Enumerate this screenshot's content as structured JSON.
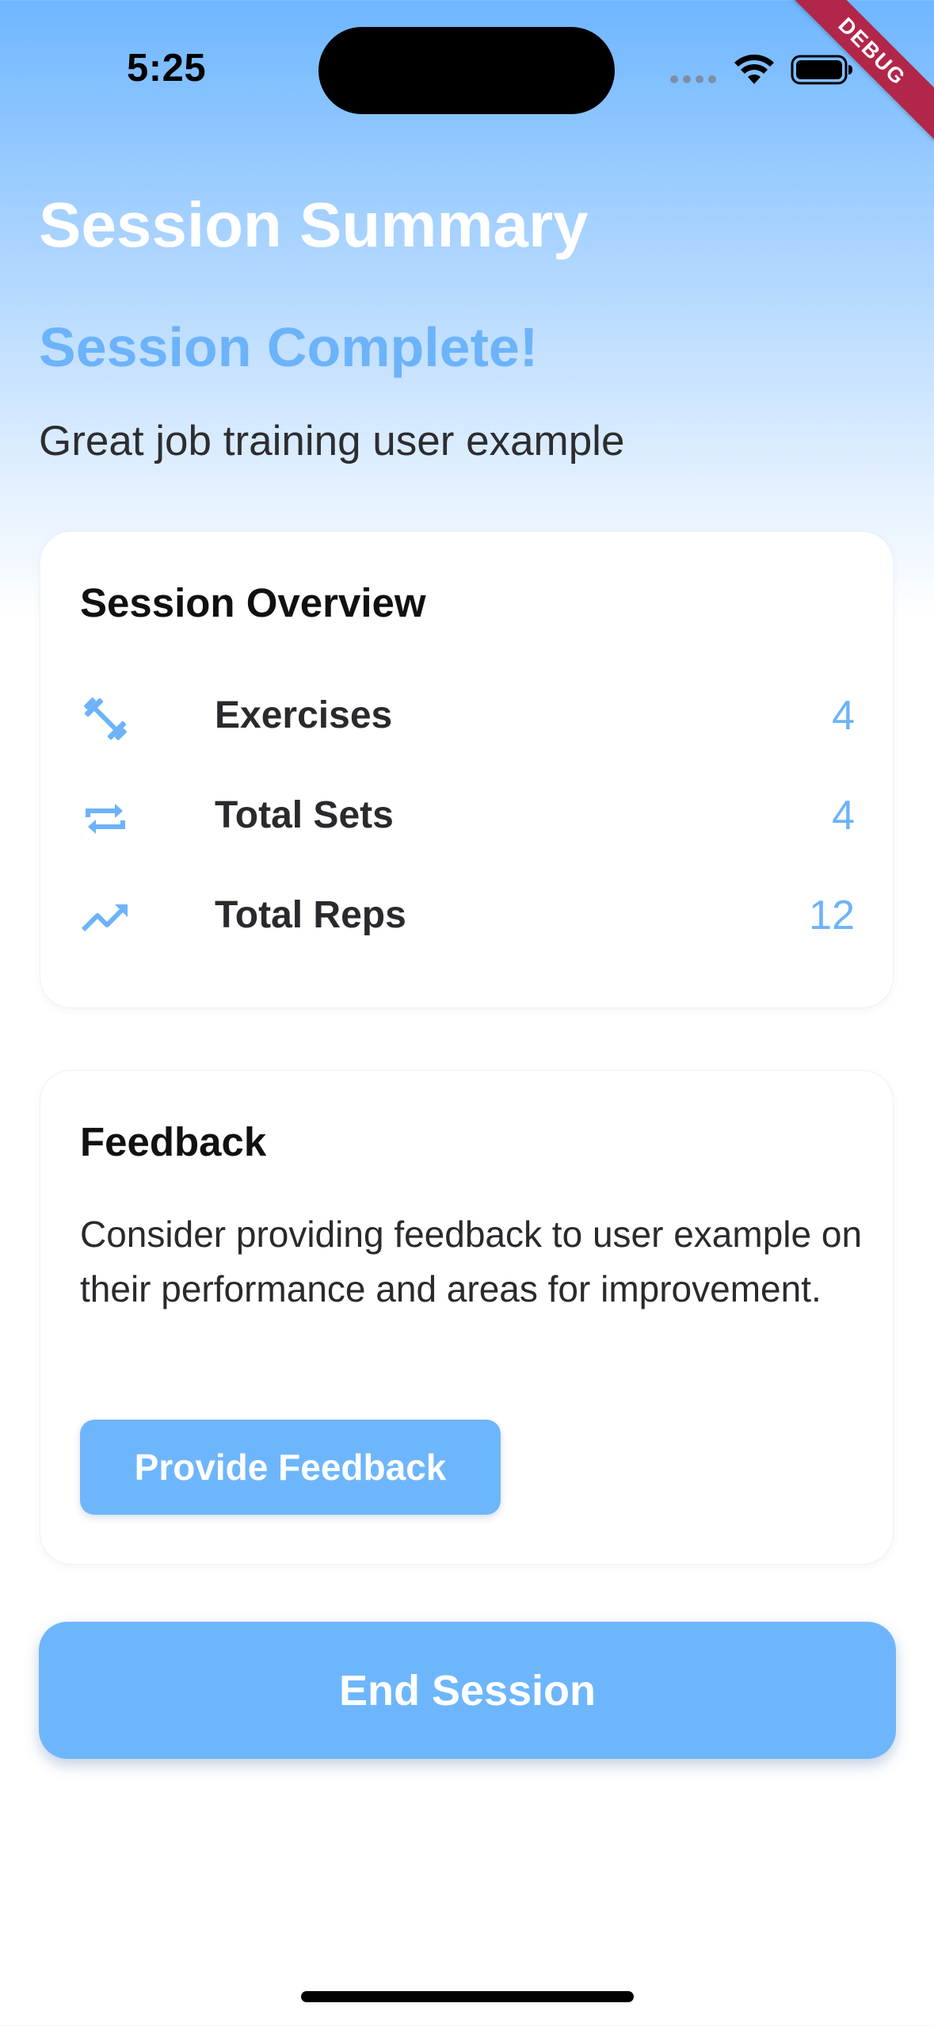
{
  "status_bar": {
    "time": "5:25",
    "icons": [
      "signal-dots",
      "wifi-icon",
      "battery-icon"
    ]
  },
  "debug_banner": "DEBUG",
  "header": {
    "title": "Session Summary",
    "complete_heading": "Session Complete!",
    "subtitle": "Great job training user example"
  },
  "overview": {
    "title": "Session Overview",
    "stats": [
      {
        "icon": "dumbbell-icon",
        "label": "Exercises",
        "value": "4"
      },
      {
        "icon": "repeat-icon",
        "label": "Total Sets",
        "value": "4"
      },
      {
        "icon": "trending-up-icon",
        "label": "Total Reps",
        "value": "12"
      }
    ]
  },
  "feedback": {
    "title": "Feedback",
    "text": "Consider providing feedback to user example on their performance and areas for improvement.",
    "button_label": "Provide Feedback"
  },
  "end_button_label": "End Session",
  "colors": {
    "accent": "#6EB6FC",
    "gradient_top": "#6EB6FF",
    "debug_banner": "#B2264A"
  }
}
